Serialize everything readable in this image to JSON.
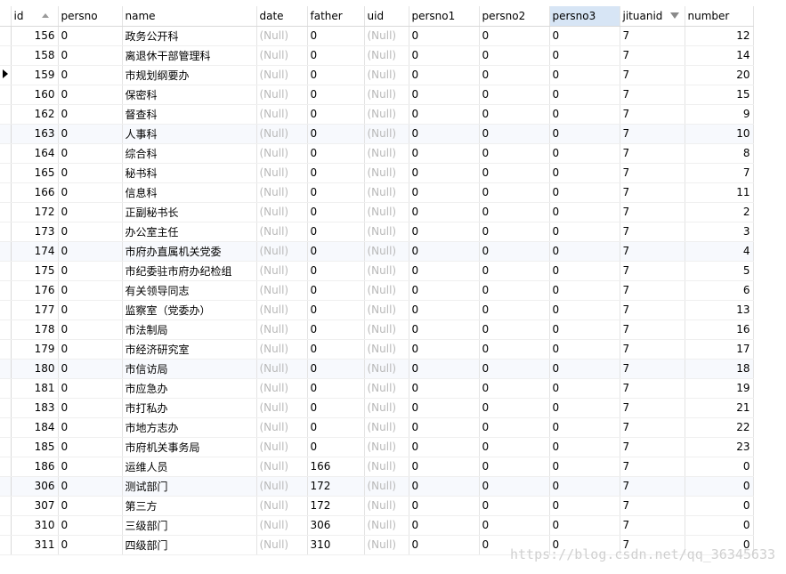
{
  "columns": [
    {
      "key": "id",
      "label": "id",
      "sort": "asc"
    },
    {
      "key": "persno",
      "label": "persno"
    },
    {
      "key": "name",
      "label": "name"
    },
    {
      "key": "date",
      "label": "date"
    },
    {
      "key": "father",
      "label": "father"
    },
    {
      "key": "uid",
      "label": "uid"
    },
    {
      "key": "persno1",
      "label": "persno1"
    },
    {
      "key": "persno2",
      "label": "persno2"
    },
    {
      "key": "persno3",
      "label": "persno3",
      "selected": true
    },
    {
      "key": "jituanid",
      "label": "jituanid",
      "filter": true
    },
    {
      "key": "number",
      "label": "number"
    }
  ],
  "current_row": 2,
  "rows": [
    {
      "id": "156",
      "persno": "0",
      "name": "政务公开科",
      "date": "(Null)",
      "father": "0",
      "uid": "(Null)",
      "persno1": "0",
      "persno2": "0",
      "persno3": "0",
      "jituanid": "7",
      "number": "12"
    },
    {
      "id": "158",
      "persno": "0",
      "name": "离退休干部管理科",
      "date": "(Null)",
      "father": "0",
      "uid": "(Null)",
      "persno1": "0",
      "persno2": "0",
      "persno3": "0",
      "jituanid": "7",
      "number": "14"
    },
    {
      "id": "159",
      "persno": "0",
      "name": "市规划纲要办",
      "date": "(Null)",
      "father": "0",
      "uid": "(Null)",
      "persno1": "0",
      "persno2": "0",
      "persno3": "0",
      "jituanid": "7",
      "number": "20"
    },
    {
      "id": "160",
      "persno": "0",
      "name": "保密科",
      "date": "(Null)",
      "father": "0",
      "uid": "(Null)",
      "persno1": "0",
      "persno2": "0",
      "persno3": "0",
      "jituanid": "7",
      "number": "15"
    },
    {
      "id": "162",
      "persno": "0",
      "name": "督查科",
      "date": "(Null)",
      "father": "0",
      "uid": "(Null)",
      "persno1": "0",
      "persno2": "0",
      "persno3": "0",
      "jituanid": "7",
      "number": "9"
    },
    {
      "id": "163",
      "persno": "0",
      "name": "人事科",
      "date": "(Null)",
      "father": "0",
      "uid": "(Null)",
      "persno1": "0",
      "persno2": "0",
      "persno3": "0",
      "jituanid": "7",
      "number": "10"
    },
    {
      "id": "164",
      "persno": "0",
      "name": "综合科",
      "date": "(Null)",
      "father": "0",
      "uid": "(Null)",
      "persno1": "0",
      "persno2": "0",
      "persno3": "0",
      "jituanid": "7",
      "number": "8"
    },
    {
      "id": "165",
      "persno": "0",
      "name": "秘书科",
      "date": "(Null)",
      "father": "0",
      "uid": "(Null)",
      "persno1": "0",
      "persno2": "0",
      "persno3": "0",
      "jituanid": "7",
      "number": "7"
    },
    {
      "id": "166",
      "persno": "0",
      "name": "信息科",
      "date": "(Null)",
      "father": "0",
      "uid": "(Null)",
      "persno1": "0",
      "persno2": "0",
      "persno3": "0",
      "jituanid": "7",
      "number": "11"
    },
    {
      "id": "172",
      "persno": "0",
      "name": "正副秘书长",
      "date": "(Null)",
      "father": "0",
      "uid": "(Null)",
      "persno1": "0",
      "persno2": "0",
      "persno3": "0",
      "jituanid": "7",
      "number": "2"
    },
    {
      "id": "173",
      "persno": "0",
      "name": "办公室主任",
      "date": "(Null)",
      "father": "0",
      "uid": "(Null)",
      "persno1": "0",
      "persno2": "0",
      "persno3": "0",
      "jituanid": "7",
      "number": "3"
    },
    {
      "id": "174",
      "persno": "0",
      "name": "市府办直属机关党委",
      "date": "(Null)",
      "father": "0",
      "uid": "(Null)",
      "persno1": "0",
      "persno2": "0",
      "persno3": "0",
      "jituanid": "7",
      "number": "4"
    },
    {
      "id": "175",
      "persno": "0",
      "name": "市纪委驻市府办纪检组",
      "date": "(Null)",
      "father": "0",
      "uid": "(Null)",
      "persno1": "0",
      "persno2": "0",
      "persno3": "0",
      "jituanid": "7",
      "number": "5"
    },
    {
      "id": "176",
      "persno": "0",
      "name": "有关领导同志",
      "date": "(Null)",
      "father": "0",
      "uid": "(Null)",
      "persno1": "0",
      "persno2": "0",
      "persno3": "0",
      "jituanid": "7",
      "number": "6"
    },
    {
      "id": "177",
      "persno": "0",
      "name": "监察室（党委办）",
      "date": "(Null)",
      "father": "0",
      "uid": "(Null)",
      "persno1": "0",
      "persno2": "0",
      "persno3": "0",
      "jituanid": "7",
      "number": "13"
    },
    {
      "id": "178",
      "persno": "0",
      "name": "市法制局",
      "date": "(Null)",
      "father": "0",
      "uid": "(Null)",
      "persno1": "0",
      "persno2": "0",
      "persno3": "0",
      "jituanid": "7",
      "number": "16"
    },
    {
      "id": "179",
      "persno": "0",
      "name": "市经济研究室",
      "date": "(Null)",
      "father": "0",
      "uid": "(Null)",
      "persno1": "0",
      "persno2": "0",
      "persno3": "0",
      "jituanid": "7",
      "number": "17"
    },
    {
      "id": "180",
      "persno": "0",
      "name": "市信访局",
      "date": "(Null)",
      "father": "0",
      "uid": "(Null)",
      "persno1": "0",
      "persno2": "0",
      "persno3": "0",
      "jituanid": "7",
      "number": "18"
    },
    {
      "id": "181",
      "persno": "0",
      "name": "市应急办",
      "date": "(Null)",
      "father": "0",
      "uid": "(Null)",
      "persno1": "0",
      "persno2": "0",
      "persno3": "0",
      "jituanid": "7",
      "number": "19"
    },
    {
      "id": "183",
      "persno": "0",
      "name": "市打私办",
      "date": "(Null)",
      "father": "0",
      "uid": "(Null)",
      "persno1": "0",
      "persno2": "0",
      "persno3": "0",
      "jituanid": "7",
      "number": "21"
    },
    {
      "id": "184",
      "persno": "0",
      "name": "市地方志办",
      "date": "(Null)",
      "father": "0",
      "uid": "(Null)",
      "persno1": "0",
      "persno2": "0",
      "persno3": "0",
      "jituanid": "7",
      "number": "22"
    },
    {
      "id": "185",
      "persno": "0",
      "name": "市府机关事务局",
      "date": "(Null)",
      "father": "0",
      "uid": "(Null)",
      "persno1": "0",
      "persno2": "0",
      "persno3": "0",
      "jituanid": "7",
      "number": "23"
    },
    {
      "id": "186",
      "persno": "0",
      "name": "运维人员",
      "date": "(Null)",
      "father": "166",
      "uid": "(Null)",
      "persno1": "0",
      "persno2": "0",
      "persno3": "0",
      "jituanid": "7",
      "number": "0"
    },
    {
      "id": "306",
      "persno": "0",
      "name": "测试部门",
      "date": "(Null)",
      "father": "172",
      "uid": "(Null)",
      "persno1": "0",
      "persno2": "0",
      "persno3": "0",
      "jituanid": "7",
      "number": "0"
    },
    {
      "id": "307",
      "persno": "0",
      "name": "第三方",
      "date": "(Null)",
      "father": "172",
      "uid": "(Null)",
      "persno1": "0",
      "persno2": "0",
      "persno3": "0",
      "jituanid": "7",
      "number": "0"
    },
    {
      "id": "310",
      "persno": "0",
      "name": "三级部门",
      "date": "(Null)",
      "father": "306",
      "uid": "(Null)",
      "persno1": "0",
      "persno2": "0",
      "persno3": "0",
      "jituanid": "7",
      "number": "0"
    },
    {
      "id": "311",
      "persno": "0",
      "name": "四级部门",
      "date": "(Null)",
      "father": "310",
      "uid": "(Null)",
      "persno1": "0",
      "persno2": "0",
      "persno3": "0",
      "jituanid": "7",
      "number": "0"
    }
  ],
  "watermark": "https://blog.csdn.net/qq_36345633"
}
